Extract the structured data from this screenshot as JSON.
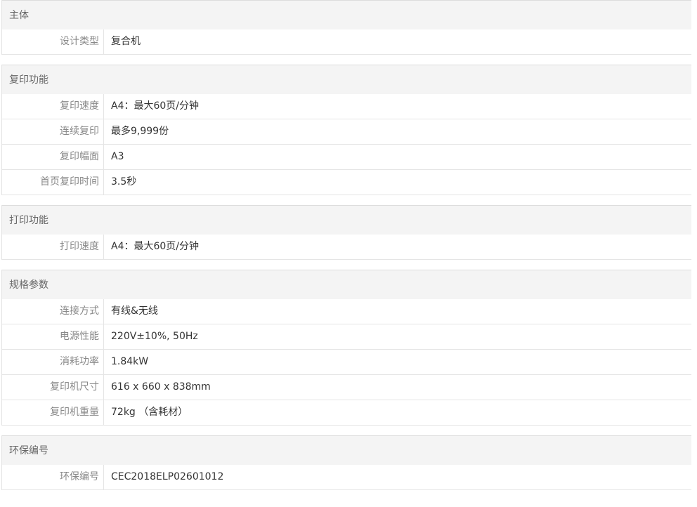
{
  "sections": [
    {
      "title": "主体",
      "rows": [
        {
          "label": "设计类型",
          "value": "复合机"
        }
      ]
    },
    {
      "title": "复印功能",
      "rows": [
        {
          "label": "复印速度",
          "value": "A4：最大60页/分钟"
        },
        {
          "label": "连续复印",
          "value": "最多9,999份"
        },
        {
          "label": "复印幅面",
          "value": "A3"
        },
        {
          "label": "首页复印时间",
          "value": "3.5秒"
        }
      ]
    },
    {
      "title": "打印功能",
      "rows": [
        {
          "label": "打印速度",
          "value": "A4：最大60页/分钟"
        }
      ]
    },
    {
      "title": "规格参数",
      "rows": [
        {
          "label": "连接方式",
          "value": "有线&无线"
        },
        {
          "label": "电源性能",
          "value": "220V±10%, 50Hz"
        },
        {
          "label": "消耗功率",
          "value": "1.84kW"
        },
        {
          "label": "复印机尺寸",
          "value": "616 x 660 x 838mm"
        },
        {
          "label": "复印机重量",
          "value": "72kg （含耗材）"
        }
      ]
    },
    {
      "title": "环保编号",
      "rows": [
        {
          "label": "环保编号",
          "value": "CEC2018ELP02601012"
        }
      ]
    }
  ]
}
